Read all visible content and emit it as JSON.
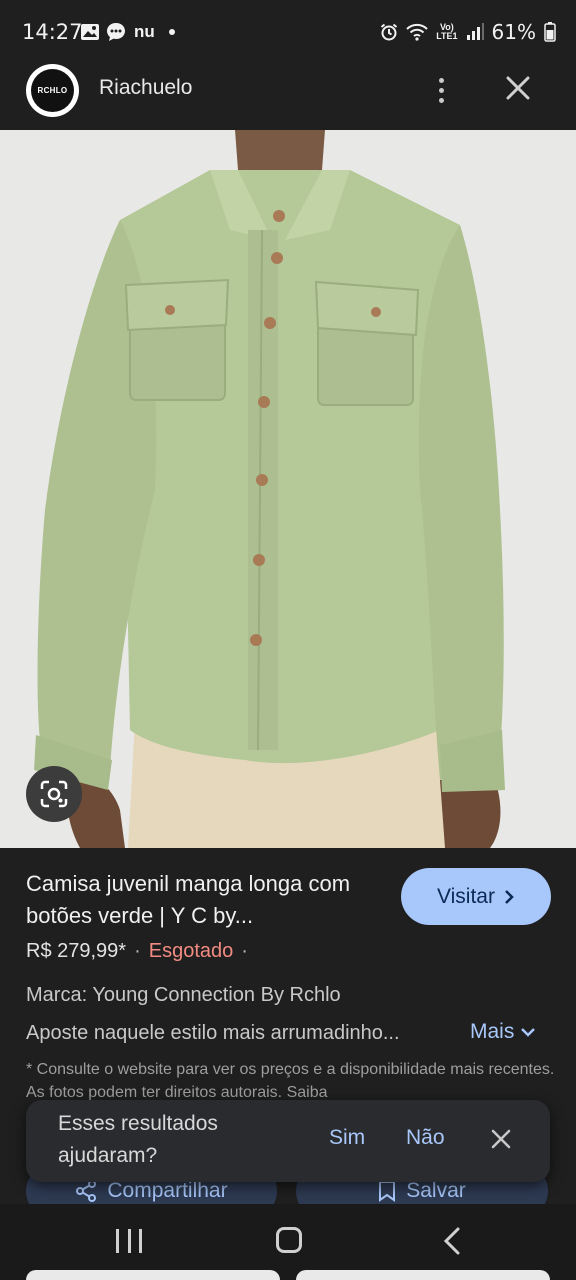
{
  "status_bar": {
    "time": "14:27",
    "app_indicator": "nu",
    "battery": "61%",
    "volte_line1": "Vo)",
    "volte_line2": "LTE1"
  },
  "header": {
    "logo_text": "RCHLO",
    "site_name": "Riachuelo",
    "icons": [
      "more-vert-icon",
      "close-icon"
    ]
  },
  "product": {
    "title": "Camisa juvenil manga longa com botões verde | Y C by...",
    "visit_label": "Visitar",
    "price": "R$ 279,99*",
    "separator": "·",
    "stock_status": "Esgotado",
    "separator2": "·",
    "brand": "Marca: Young Connection By Rchlo",
    "description": "Aposte naquele estilo mais arrumadinho...",
    "more_label": "Mais",
    "disclaimer": "* Consulte o website para ver os preços e a disponibilidade mais recentes. As fotos podem ter direitos autorais. Saiba",
    "share_label": "Compartilhar",
    "save_label": "Salvar"
  },
  "feedback": {
    "question": "Esses resultados ajudaram?",
    "yes_label": "Sim",
    "no_label": "Não"
  },
  "colors": {
    "background": "#1f1f1f",
    "accent": "#a8c7fa",
    "stock_out": "#f28b82",
    "shirt": "#b7c99a"
  }
}
